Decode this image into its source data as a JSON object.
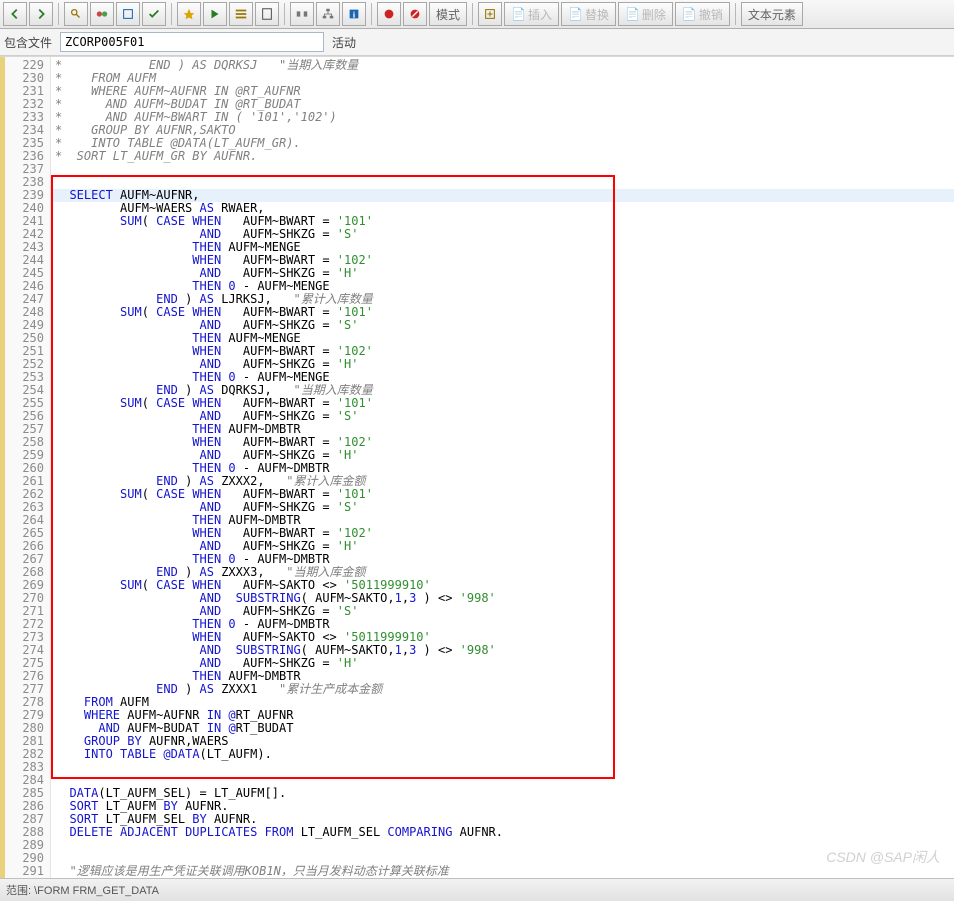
{
  "toolbar": {
    "mode_label": "模式",
    "insert_label": "插入",
    "replace_label": "替换",
    "delete_label": "删除",
    "undo_label": "撤销",
    "text_element_label": "文本元素"
  },
  "fileline": {
    "include_label": "包含文件",
    "include_value": "ZCORP005F01",
    "status_label": "活动"
  },
  "editor": {
    "first_line": 229,
    "last_line": 291,
    "selected_line": 239,
    "red_box": {
      "from": 238,
      "to": 283
    },
    "lines": [
      "*            END ) AS DQRKSJ   \"当期入库数量",
      "*    FROM AUFM",
      "*    WHERE AUFM~AUFNR IN @RT_AUFNR",
      "*      AND AUFM~BUDAT IN @RT_BUDAT",
      "*      AND AUFM~BWART IN ( '101','102')",
      "*    GROUP BY AUFNR,SAKTO",
      "*    INTO TABLE @DATA(LT_AUFM_GR).",
      "*  SORT LT_AUFM_GR BY AUFNR.",
      "",
      "",
      "  SELECT AUFM~AUFNR,",
      "         AUFM~WAERS AS RWAER,",
      "         SUM( CASE WHEN   AUFM~BWART = '101'",
      "                    AND   AUFM~SHKZG = 'S'",
      "                   THEN AUFM~MENGE",
      "                   WHEN   AUFM~BWART = '102'",
      "                    AND   AUFM~SHKZG = 'H'",
      "                   THEN 0 - AUFM~MENGE",
      "              END ) AS LJRKSJ,   \"累计入库数量",
      "         SUM( CASE WHEN   AUFM~BWART = '101'",
      "                    AND   AUFM~SHKZG = 'S'",
      "                   THEN AUFM~MENGE",
      "                   WHEN   AUFM~BWART = '102'",
      "                    AND   AUFM~SHKZG = 'H'",
      "                   THEN 0 - AUFM~MENGE",
      "              END ) AS DQRKSJ,   \"当期入库数量",
      "         SUM( CASE WHEN   AUFM~BWART = '101'",
      "                    AND   AUFM~SHKZG = 'S'",
      "                   THEN AUFM~DMBTR",
      "                   WHEN   AUFM~BWART = '102'",
      "                    AND   AUFM~SHKZG = 'H'",
      "                   THEN 0 - AUFM~DMBTR",
      "              END ) AS ZXXX2,   \"累计入库金额",
      "         SUM( CASE WHEN   AUFM~BWART = '101'",
      "                    AND   AUFM~SHKZG = 'S'",
      "                   THEN AUFM~DMBTR",
      "                   WHEN   AUFM~BWART = '102'",
      "                    AND   AUFM~SHKZG = 'H'",
      "                   THEN 0 - AUFM~DMBTR",
      "              END ) AS ZXXX3,   \"当期入库金额",
      "         SUM( CASE WHEN   AUFM~SAKTO <> '5011999910'",
      "                    AND  SUBSTRING( AUFM~SAKTO,1,3 ) <> '998'",
      "                    AND   AUFM~SHKZG = 'S'",
      "                   THEN 0 - AUFM~DMBTR",
      "                   WHEN   AUFM~SAKTO <> '5011999910'",
      "                    AND  SUBSTRING( AUFM~SAKTO,1,3 ) <> '998'",
      "                    AND   AUFM~SHKZG = 'H'",
      "                   THEN AUFM~DMBTR",
      "              END ) AS ZXXX1   \"累计生产成本金额",
      "    FROM AUFM",
      "    WHERE AUFM~AUFNR IN @RT_AUFNR",
      "      AND AUFM~BUDAT IN @RT_BUDAT",
      "    GROUP BY AUFNR,WAERS",
      "    INTO TABLE @DATA(LT_AUFM).",
      "",
      "",
      "  DATA(LT_AUFM_SEL) = LT_AUFM[].",
      "  SORT LT_AUFM BY AUFNR.",
      "  SORT LT_AUFM_SEL BY AUFNR.",
      "  DELETE ADJACENT DUPLICATES FROM LT_AUFM_SEL COMPARING AUFNR.",
      "",
      "",
      "  \"逻辑应该是用生产凭证关联调用KOB1N，只当月发料动态计算关联标准"
    ]
  },
  "statusbar": {
    "text": "范围:  \\FORM FRM_GET_DATA"
  },
  "watermark": "CSDN @SAP闲人"
}
